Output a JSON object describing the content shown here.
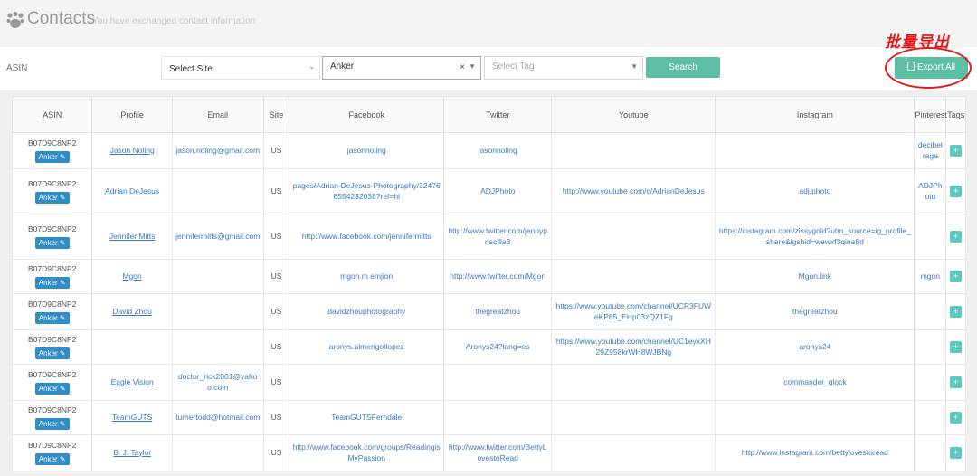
{
  "header": {
    "title": "Contacts",
    "subtitle": "You have exchanged contact information"
  },
  "filters": {
    "asin_placeholder": "ASIN",
    "site_placeholder": "Select Site",
    "brand_value": "Anker",
    "tag_placeholder": "Select Tag",
    "search_label": "Search",
    "export_label": "Export All"
  },
  "annotation": {
    "label": "批量导出",
    "color": "#e11c1c"
  },
  "columns": [
    "ASIN",
    "Profile",
    "Email",
    "Site",
    "Facebook",
    "Twitter",
    "Youtube",
    "Instagram",
    "Pinterest",
    "Tags"
  ],
  "badge_label": "Anker",
  "plus_label": "+",
  "rows": [
    {
      "asin": "B07D9C8NP2",
      "profile": "Jason Noling",
      "email": "jason.noling@gmail.com",
      "site": "US",
      "facebook": "jasonnoling",
      "twitter": "jasonnoling",
      "youtube": "",
      "instagram": "",
      "pinterest": "decibelrage"
    },
    {
      "asin": "B07D9C8NP2",
      "profile": "Adrian DeJesus",
      "email": "",
      "site": "US",
      "facebook": "pages/Adrian-DeJesus-Photography/324766554232038?ref=hl",
      "twitter": "ADJPhoto",
      "youtube": "http://www.youtube.com/c/AdrianDeJesus",
      "instagram": "adj.photo",
      "pinterest": "ADJPhoto"
    },
    {
      "asin": "B07D9C8NP2",
      "profile": "Jennifer Mitts",
      "email": "jennifermitts@gmail.com",
      "site": "US",
      "facebook": "http://www.facebook.com/jennifermitts",
      "twitter": "http://www.twitter.com/jennypriscilla3",
      "youtube": "",
      "instagram": "https://instagram.com/zissygold?utm_source=ig_profile_share&igshid=wewxf3qina8d",
      "pinterest": ""
    },
    {
      "asin": "B07D9C8NP2",
      "profile": "Mgon",
      "email": "",
      "site": "US",
      "facebook": "mgon.m.emjion",
      "twitter": "http://www.twitter.com/Mgon",
      "youtube": "",
      "instagram": "Mgon.link",
      "pinterest": "mgon"
    },
    {
      "asin": "B07D9C8NP2",
      "profile": "David Zhou",
      "email": "",
      "site": "US",
      "facebook": "davidzhouphotography",
      "twitter": "thegreatzhou",
      "youtube": "https://www.youtube.com/channel/UCR3FUWeKP85_EHp03zQZ1Fg",
      "instagram": "thegreatzhou",
      "pinterest": ""
    },
    {
      "asin": "B07D9C8NP2",
      "profile": "",
      "email": "",
      "site": "US",
      "facebook": "aronys.almengotlopez",
      "twitter": "Aronys24?lang=es",
      "youtube": "https://www.youtube.com/channel/UC1eyxXH29Z958krWH8WJBNg",
      "instagram": "aronys24",
      "pinterest": ""
    },
    {
      "asin": "B07D9C8NP2",
      "profile": "Eagle Vision",
      "email": "doctor_rick2001@yahoo.com",
      "site": "US",
      "facebook": "",
      "twitter": "",
      "youtube": "",
      "instagram": "commander_glock",
      "pinterest": ""
    },
    {
      "asin": "B07D9C8NP2",
      "profile": "TeamGUTS",
      "email": "turnertodd@hotmail.com",
      "site": "US",
      "facebook": "TeamGUTSFerndale",
      "twitter": "",
      "youtube": "",
      "instagram": "",
      "pinterest": ""
    },
    {
      "asin": "B07D9C8NP2",
      "profile": "B. J. Taylor",
      "email": "",
      "site": "US",
      "facebook": "http://www.facebook.com/groups/ReadingisMyPassion",
      "twitter": "http://www.twitter.com/BettyLovestoRead",
      "youtube": "",
      "instagram": "http://www.instagram.com/bettylovestoread",
      "pinterest": ""
    }
  ]
}
